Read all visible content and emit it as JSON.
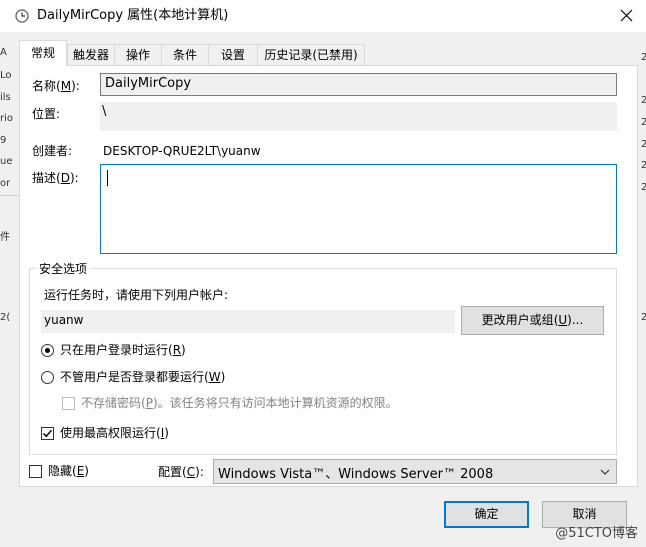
{
  "window": {
    "title": "DailyMirCopy 属性(本地计算机)",
    "title_icon": "clock-icon",
    "close_glyph": "✕"
  },
  "background_bleed": {
    "left": [
      "A",
      "Lo",
      "ils",
      "rio",
      "9",
      "ue",
      "or",
      "件",
      "2(",
      "2("
    ],
    "right": [
      "2",
      "2",
      "2",
      "2",
      "2",
      "2",
      "2"
    ]
  },
  "tabs": [
    {
      "label": "常规",
      "active": true
    },
    {
      "label": "触发器",
      "active": false
    },
    {
      "label": "操作",
      "active": false
    },
    {
      "label": "条件",
      "active": false
    },
    {
      "label": "设置",
      "active": false
    },
    {
      "label": "历史记录(已禁用)",
      "active": false
    }
  ],
  "general": {
    "name_label": "名称",
    "name_hotkey": "M",
    "name_value": "DailyMirCopy",
    "location_label": "位置:",
    "location_value": "\\",
    "author_label": "创建者:",
    "author_value": "DESKTOP-QRUE2LT\\yuanw",
    "desc_label": "描述",
    "desc_hotkey": "D",
    "desc_value": ""
  },
  "security": {
    "legend": "安全选项",
    "run_as_label": "运行任务时，请使用下列用户帐户:",
    "user_value": "yuanw",
    "change_user_btn": "更改用户或组",
    "change_user_hotkey": "U",
    "change_user_suffix": "...",
    "radio_logged_on": "只在用户登录时运行",
    "radio_logged_on_hotkey": "R",
    "radio_logged_on_checked": true,
    "radio_any": "不管用户是否登录都要运行",
    "radio_any_hotkey": "W",
    "radio_any_checked": false,
    "no_store_pw_prefix": "不存储密码",
    "no_store_pw_hotkey": "P",
    "no_store_pw_suffix": "。该任务将只有访问本地计算机资源的权限。",
    "highest_priv": "使用最高权限运行",
    "highest_priv_hotkey": "I",
    "highest_priv_checked": true
  },
  "footer": {
    "hidden_label": "隐藏",
    "hidden_hotkey": "E",
    "hidden_checked": false,
    "config_label": "配置",
    "config_hotkey": "C",
    "config_value": "Windows Vista™、Windows Server™ 2008",
    "ok_btn": "确定",
    "cancel_btn": "取消"
  },
  "watermark": "@51CTO博客",
  "colors": {
    "accent": "#0078d7",
    "panel_bg": "#ffffff",
    "window_bg": "#f0f0f0"
  }
}
